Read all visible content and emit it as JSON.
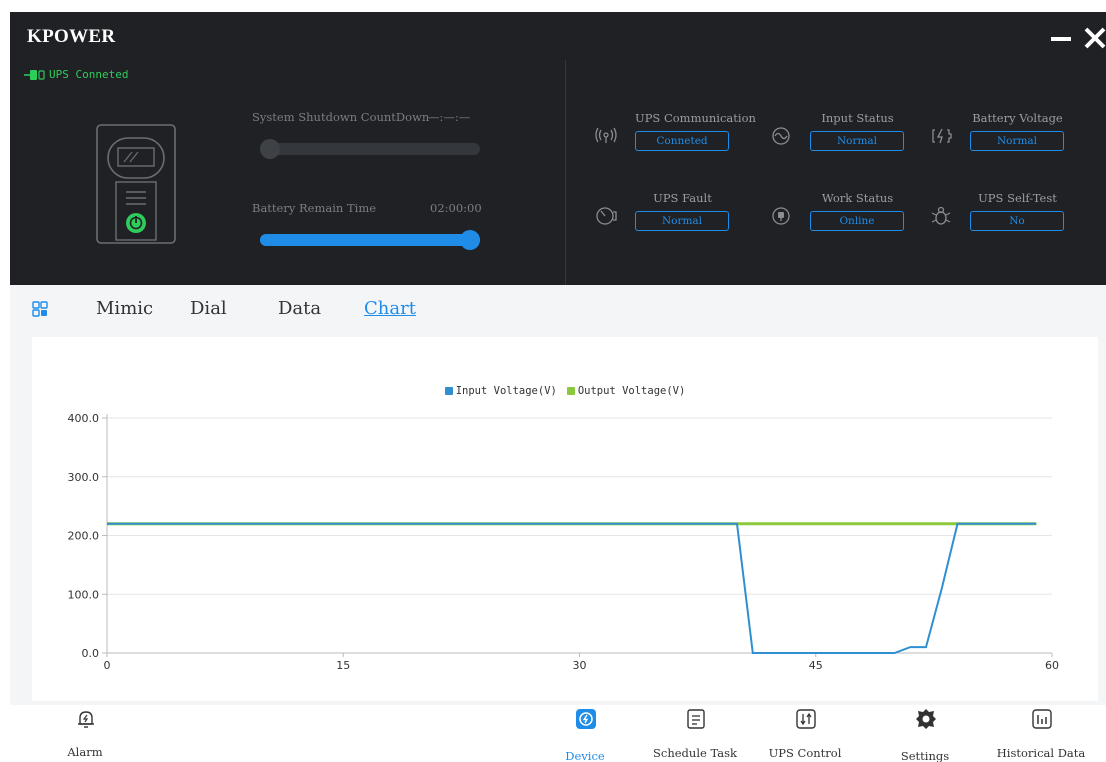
{
  "app": {
    "title": "KPOWER"
  },
  "connection": {
    "status": "UPS Conneted",
    "color": "#2ecc5b"
  },
  "countdown": {
    "shutdown_label": "System Shutdown CountDown",
    "shutdown_value": "—:—:—",
    "shutdown_progress": 0,
    "battery_label": "Battery Remain Time",
    "battery_value": "02:00:00",
    "battery_progress": 1.0
  },
  "status_items": [
    {
      "label": "UPS Communication",
      "value": "Conneted",
      "icon": "signal-tower-icon"
    },
    {
      "label": "Input Status",
      "value": "Normal",
      "icon": "sine-wave-icon"
    },
    {
      "label": "Battery Voltage",
      "value": "Normal",
      "icon": "battery-charge-icon"
    },
    {
      "label": "UPS Fault",
      "value": "Normal",
      "icon": "gauge-icon"
    },
    {
      "label": "Work Status",
      "value": "Online",
      "icon": "power-plug-icon"
    },
    {
      "label": "UPS Self-Test",
      "value": "No",
      "icon": "bug-icon"
    }
  ],
  "tabs": [
    "Mimic",
    "Dial",
    "Data",
    "Chart"
  ],
  "active_tab": "Chart",
  "chart_data": {
    "type": "line",
    "x": [
      0,
      1,
      2,
      3,
      4,
      5,
      6,
      7,
      8,
      9,
      10,
      11,
      12,
      13,
      14,
      15,
      16,
      17,
      18,
      19,
      20,
      21,
      22,
      23,
      24,
      25,
      26,
      27,
      28,
      29,
      30,
      31,
      32,
      33,
      34,
      35,
      36,
      37,
      38,
      39,
      40,
      41,
      42,
      43,
      44,
      45,
      46,
      47,
      48,
      49,
      50,
      51,
      52,
      53,
      54,
      55,
      56,
      57,
      58,
      59
    ],
    "series": [
      {
        "name": "Input Voltage(V)",
        "color": "#2f8fd0",
        "values": [
          220,
          220,
          220,
          220,
          220,
          220,
          220,
          220,
          220,
          220,
          220,
          220,
          220,
          220,
          220,
          220,
          220,
          220,
          220,
          220,
          220,
          220,
          220,
          220,
          220,
          220,
          220,
          220,
          220,
          220,
          220,
          220,
          220,
          220,
          220,
          220,
          220,
          220,
          220,
          220,
          220,
          0,
          0,
          0,
          0,
          0,
          0,
          0,
          0,
          0,
          0,
          10,
          10,
          110,
          220,
          220,
          220,
          220,
          220,
          220
        ]
      },
      {
        "name": "Output Voltage(V)",
        "color": "#8cc83c",
        "values": [
          220,
          220,
          220,
          220,
          220,
          220,
          220,
          220,
          220,
          220,
          220,
          220,
          220,
          220,
          220,
          220,
          220,
          220,
          220,
          220,
          220,
          220,
          220,
          220,
          220,
          220,
          220,
          220,
          220,
          220,
          220,
          220,
          220,
          220,
          220,
          220,
          220,
          220,
          220,
          220,
          220,
          220,
          220,
          220,
          220,
          220,
          220,
          220,
          220,
          220,
          220,
          220,
          220,
          220,
          220,
          220,
          220,
          220,
          220,
          220
        ]
      }
    ],
    "y_ticks": [
      "400.0",
      "300.0",
      "200.0",
      "100.0",
      "0.0"
    ],
    "x_ticks": [
      "0",
      "15",
      "30",
      "45",
      "60"
    ],
    "xlim": [
      0,
      60
    ],
    "ylim": [
      0,
      400
    ],
    "grid": true,
    "legend_position": "top-center"
  },
  "bottom_nav": [
    {
      "label": "Alarm",
      "icon": "alarm-bell-icon",
      "active": false
    },
    {
      "label": "Device",
      "icon": "device-power-icon",
      "active": true
    },
    {
      "label": "Schedule Task",
      "icon": "schedule-doc-icon",
      "active": false
    },
    {
      "label": "UPS Control",
      "icon": "control-sliders-icon",
      "active": false
    },
    {
      "label": "Settings",
      "icon": "gear-icon",
      "active": false
    },
    {
      "label": "Historical Data",
      "icon": "bar-chart-icon",
      "active": false
    }
  ],
  "colors": {
    "accent": "#1f8de8",
    "panel": "#1f2125",
    "success": "#2ecc5b"
  }
}
